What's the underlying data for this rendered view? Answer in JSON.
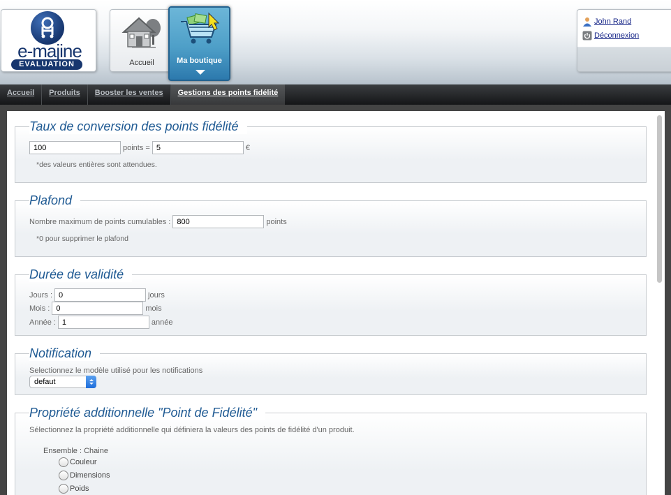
{
  "brand": {
    "logo_text": "e-majine",
    "logo_badge": "EVALUATION"
  },
  "top_nav": [
    {
      "label": "Accueil"
    },
    {
      "label": "Ma boutique"
    }
  ],
  "user": {
    "name": "John Rand",
    "logout": "Déconnexion"
  },
  "menu": [
    {
      "label": "Accueil"
    },
    {
      "label": "Produits"
    },
    {
      "label": "Booster les ventes"
    },
    {
      "label": "Gestions des points fidélité"
    }
  ],
  "sections": {
    "conversion": {
      "title": "Taux de conversion des points fidélité",
      "points_value": "100",
      "points_unit": "points =",
      "euro_value": "5",
      "euro_unit": "€",
      "note": "*des valeurs entières sont attendues."
    },
    "plafond": {
      "title": "Plafond",
      "label": "Nombre maximum de points cumulables :",
      "value": "800",
      "unit": "points",
      "note": "*0 pour supprimer le plafond"
    },
    "validite": {
      "title": "Durée de validité",
      "jours_label": "Jours :",
      "jours_value": "0",
      "jours_unit": "jours",
      "mois_label": "Mois :",
      "mois_value": "0",
      "mois_unit": "mois",
      "annee_label": "Année :",
      "annee_value": "1",
      "annee_unit": "année"
    },
    "notification": {
      "title": "Notification",
      "label": "Selectionnez le modèle utilisé pour les notifications",
      "selected": "defaut"
    },
    "propriete": {
      "title": "Propriété additionnelle \"Point de Fidélité\"",
      "description": "Sélectionnez la propriété additionnelle qui définiera la valeurs des points de fidélité d'un produit.",
      "group_label": "Ensemble : Chaine",
      "options": [
        "Couleur",
        "Dimensions",
        "Poids"
      ]
    }
  }
}
